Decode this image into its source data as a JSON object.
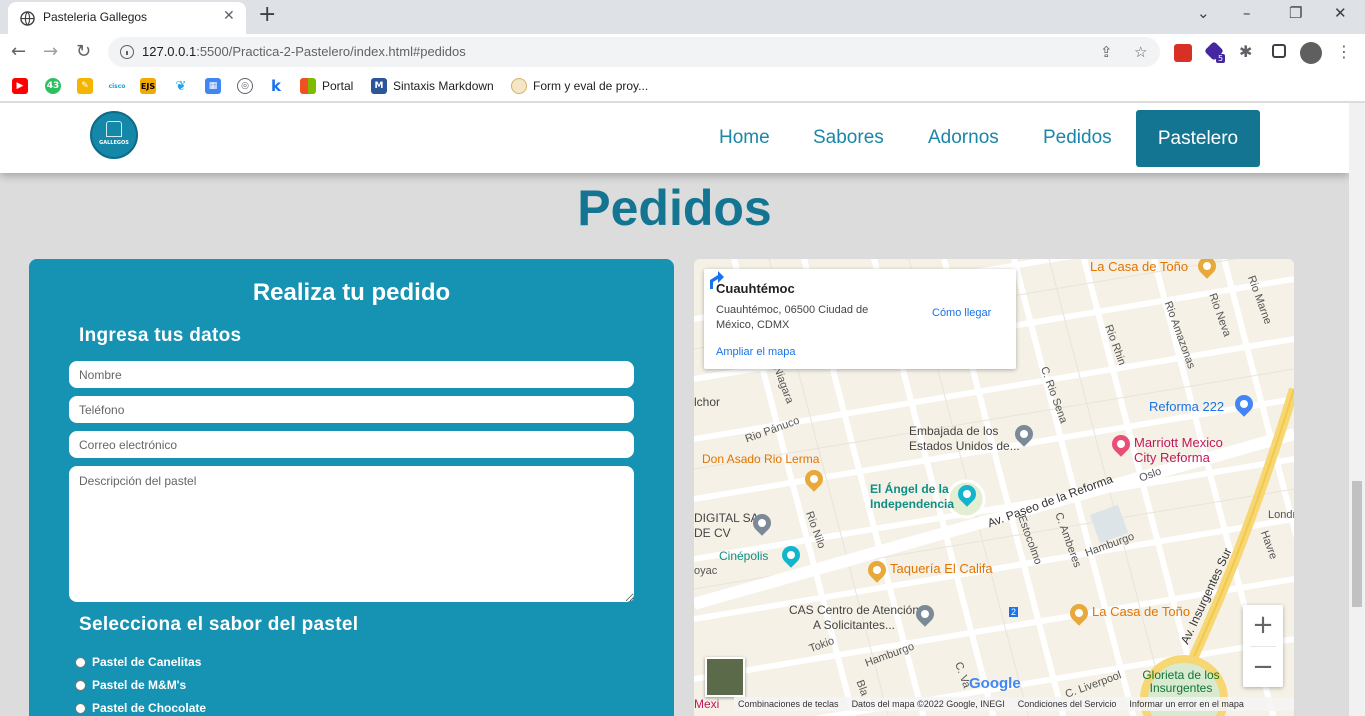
{
  "browser": {
    "tab_title": "Pasteleria Gallegos",
    "url_host": "127.0.0.1",
    "url_rest": ":5500/Practica-2-Pastelero/index.html#pedidos",
    "ext_badge": "5",
    "bookmarks": [
      {
        "label": "",
        "color": "#ff0000",
        "icon": "youtube-icon"
      },
      {
        "label": "",
        "color": "#2dbe60",
        "icon": "counter-43-icon",
        "badge": "43"
      },
      {
        "label": "",
        "color": "#f4b400",
        "icon": "pencil-icon"
      },
      {
        "label": "",
        "color": "#1ba0d7",
        "icon": "cisco-icon",
        "badge": "cisco"
      },
      {
        "label": "",
        "color": "#f2a900",
        "icon": "ejs-icon",
        "badge": "EJS"
      },
      {
        "label": "",
        "color": "#1da1f2",
        "icon": "twitter-icon"
      },
      {
        "label": "",
        "color": "#4285f4",
        "icon": "calendar-icon"
      },
      {
        "label": "",
        "color": "#5f6368",
        "icon": "compass-icon"
      },
      {
        "label": "",
        "color": "#1a73e8",
        "icon": "k-icon",
        "badge": "k"
      },
      {
        "label": "Portal",
        "color": "#f25022",
        "icon": "microsoft-icon"
      },
      {
        "label": "Sintaxis Markdown",
        "color": "#2b579a",
        "icon": "markdown-icon"
      },
      {
        "label": "Form y eval de proy...",
        "color": "#d4b16a",
        "icon": "document-icon"
      }
    ]
  },
  "site": {
    "logo_text": "GALLEGOS",
    "nav": [
      "Home",
      "Sabores",
      "Adornos",
      "Pedidos"
    ],
    "nav_active": "Pastelero",
    "section_title": "Pedidos"
  },
  "form": {
    "title": "Realiza tu pedido",
    "datos_heading": "Ingresa tus datos",
    "placeholders": {
      "nombre": "Nombre",
      "telefono": "Teléfono",
      "correo": "Correo electrónico",
      "descripcion": "Descripción del pastel"
    },
    "sabor_heading": "Selecciona el sabor del pastel",
    "sabores": [
      "Pastel de Canelitas",
      "Pastel de M&M's",
      "Pastel de Chocolate"
    ]
  },
  "map": {
    "place": "Cuauhtémoc",
    "address": "Cuauhtémoc, 06500 Ciudad de México, CDMX",
    "directions": "Cómo llegar",
    "enlarge": "Ampliar el mapa",
    "pois": {
      "casa_tono_1": "La Casa de Toño",
      "reforma222": "Reforma 222",
      "embajada": "Embajada de los Estados Unidos de...",
      "marriott": "Marriott Mexico City Reforma",
      "don_asado": "Don Asado Rio Lerma",
      "angel": "El Ángel de la Independencia",
      "digital": "DIGITAL SA DE CV",
      "cinepolis": "Cinépolis",
      "taqueria": "Taquería El Califa",
      "cas": "CAS Centro de Atención A Solicitantes...",
      "casa_tono_2": "La Casa de Toño",
      "glorieta": "Glorieta de los Insurgentes",
      "streets": {
        "rio_rhin": "Rio Rhin",
        "rio_amazonas": "Rio Amazonas",
        "rio_neva": "Rio Neva",
        "rio_marne": "Rio Marne",
        "rio_sena": "C. Rio Sena",
        "niagara": "Niagara",
        "rio_panuco": "Rio Pánuco",
        "paseo_reforma": "Av. Paseo de la Reforma",
        "oslo": "Oslo",
        "rio_nilo": "Rio Nilo",
        "estocolmo": "Estocolmo",
        "amberes": "C. Amberes",
        "hamburgo": "Hamburgo",
        "hamburgo2": "Hamburgo",
        "insurgentes": "Av. Insurgentes Sur",
        "liverpool": "C. Liverpool",
        "tokio": "Tokio",
        "havre": "Havre",
        "londres": "Londr",
        "vado": "C. Va",
        "bla": "Bla",
        "rioyac": "oyac",
        "chor": "lchor",
        "mexi": "Mexi",
        "rs": "S"
      }
    },
    "zoom_in": "+",
    "zoom_out": "−",
    "google": "Google",
    "footer": [
      "Combinaciones de teclas",
      "Datos del mapa ©2022 Google, INEGI",
      "Condiciones del Servicio",
      "Informar un error en el mapa"
    ],
    "badge_2": "2"
  }
}
